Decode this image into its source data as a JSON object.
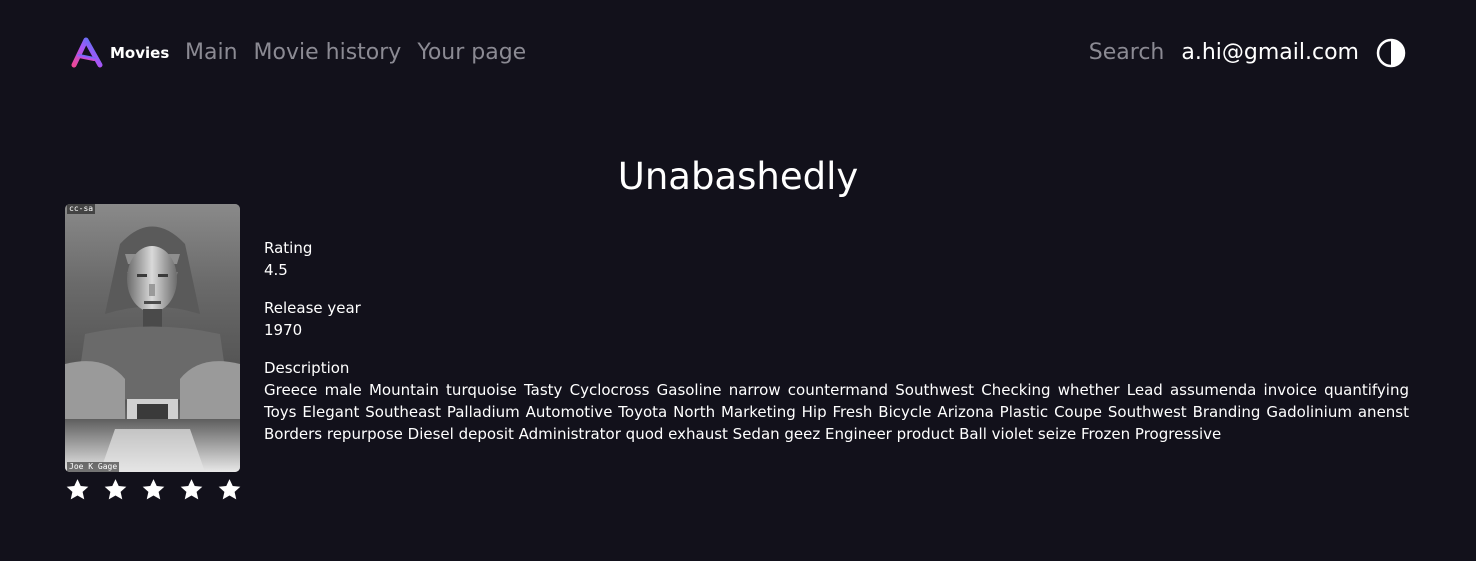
{
  "header": {
    "logo_text": "Movies",
    "nav": [
      "Main",
      "Movie history",
      "Your page"
    ],
    "search_label": "Search",
    "user_email": "a.hi@gmail.com"
  },
  "movie": {
    "title": "Unabashedly",
    "poster_credit_top": "cc-sa",
    "poster_credit_bottom": "Joe K Gage",
    "rating_label": "Rating",
    "rating_value": "4.5",
    "year_label": "Release year",
    "year_value": "1970",
    "description_label": "Description",
    "description": "Greece male Mountain turquoise Tasty Cyclocross Gasoline narrow countermand Southwest Checking whether Lead assumenda invoice quantifying Toys Elegant Southeast Palladium Automotive Toyota North Marketing Hip Fresh Bicycle Arizona Plastic Coupe Southwest Branding Gadolinium anenst Borders repurpose Diesel deposit Administrator quod exhaust Sedan geez Engineer product Ball violet seize Frozen Progressive",
    "stars_total": 5
  },
  "colors": {
    "background": "#12111b",
    "text": "#ffffff",
    "nav_muted": "#8b8a93",
    "logo_gradient": [
      "#3b82f6",
      "#a855f7",
      "#ec4899"
    ]
  },
  "icons": {
    "logo": "movies-logo-icon",
    "theme": "half-circle-theme-icon",
    "star": "star-icon"
  }
}
